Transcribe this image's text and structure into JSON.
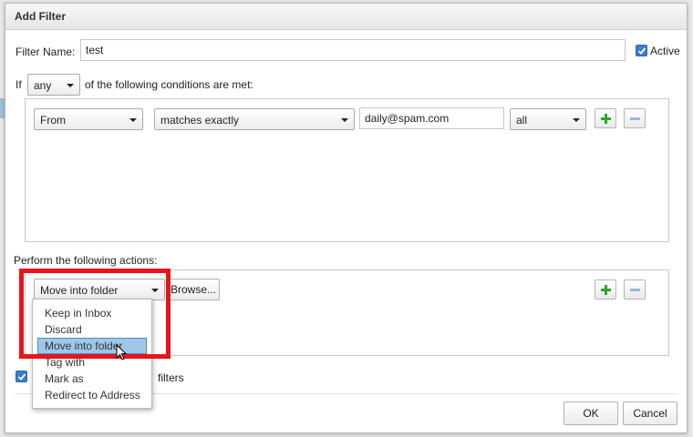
{
  "dialog": {
    "title": "Add Filter",
    "filter_name_label": "Filter Name:",
    "filter_name_value": "test",
    "active_label": "Active",
    "active_checked": true,
    "if_label": "If",
    "match_select": "any",
    "conditions_suffix": "of the following conditions are met:",
    "condition": {
      "field": "From",
      "operator": "matches exactly",
      "value": "daily@spam.com",
      "part": "all"
    },
    "actions_label": "Perform the following actions:",
    "action": {
      "type": "Move into folder",
      "browse_label": "Browse..."
    },
    "action_menu": {
      "items": [
        "Keep in Inbox",
        "Discard",
        "Move into folder",
        "Tag with",
        "Mark as",
        "Redirect to Address"
      ],
      "selected": "Move into folder"
    },
    "stop_checkbox_checked": true,
    "stop_label_tail": "filters",
    "ok_label": "OK",
    "cancel_label": "Cancel"
  },
  "colors": {
    "highlight": "#e8141b",
    "checkbox": "#3d7cc9",
    "menu_selection": "#9ec8ea",
    "add_icon": "#2ea52e"
  }
}
